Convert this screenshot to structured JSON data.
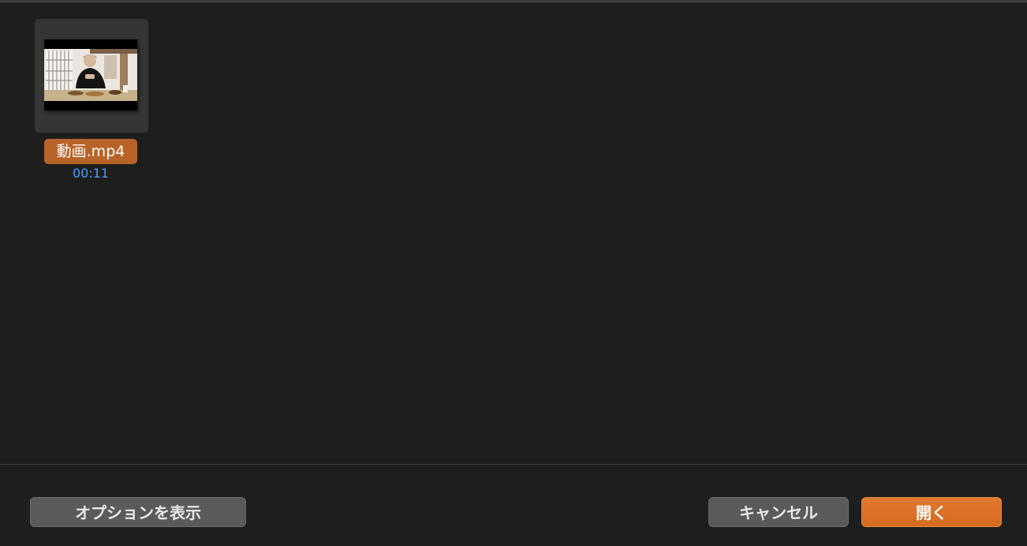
{
  "files": [
    {
      "name": "動画.mp4",
      "duration": "00:11",
      "thumbnail_icon": "video-thumbnail-icon",
      "selected": true
    }
  ],
  "footer": {
    "options_label": "オプションを表示",
    "cancel_label": "キャンセル",
    "open_label": "開く"
  },
  "colors": {
    "background": "#1e1e1e",
    "selection": "#b8632a",
    "duration_text": "#4a9ef7",
    "primary_button": "#e0792e",
    "secondary_button": "#5a5a5a"
  }
}
